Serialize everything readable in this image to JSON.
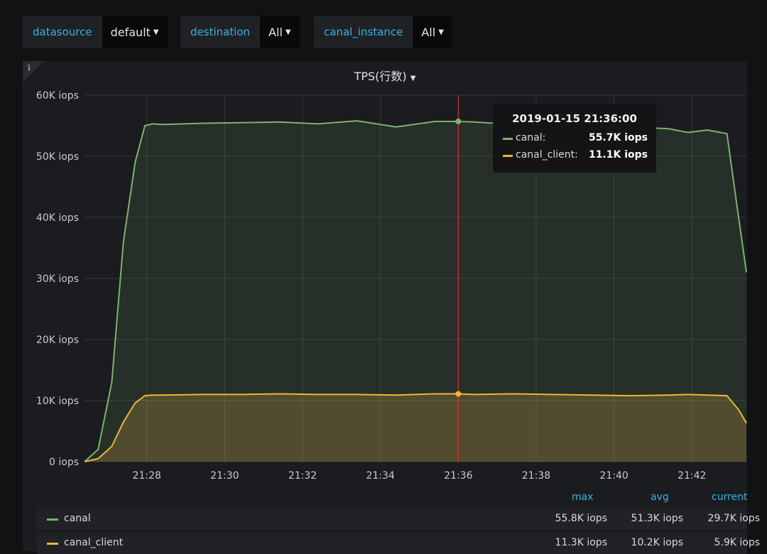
{
  "variables": [
    {
      "label": "datasource",
      "value": "default"
    },
    {
      "label": "destination",
      "value": "All"
    },
    {
      "label": "canal_instance",
      "value": "All"
    }
  ],
  "panel": {
    "title": "TPS(行数)",
    "info": "i"
  },
  "colors": {
    "canal": "#7eb26d",
    "canal_client": "#eab839",
    "crosshair": "#e02f2f",
    "accent": "#33b5e5"
  },
  "tooltip": {
    "time": "2019-01-15 21:36:00",
    "rows": [
      {
        "name": "canal:",
        "value": "55.7K iops"
      },
      {
        "name": "canal_client:",
        "value": "11.1K iops"
      }
    ]
  },
  "legend": {
    "headers": {
      "max": "max",
      "avg": "avg",
      "current": "current"
    },
    "rows": [
      {
        "name": "canal",
        "max": "55.8K iops",
        "avg": "51.3K iops",
        "current": "29.7K iops"
      },
      {
        "name": "canal_client",
        "max": "11.3K iops",
        "avg": "10.2K iops",
        "current": "5.9K iops"
      }
    ]
  },
  "chart_data": {
    "type": "area",
    "x_ticks": [
      "21:28",
      "21:30",
      "21:32",
      "21:34",
      "21:36",
      "21:38",
      "21:40",
      "21:42"
    ],
    "y_ticks": [
      "0 iops",
      "10K iops",
      "20K iops",
      "30K iops",
      "40K iops",
      "50K iops",
      "60K iops"
    ],
    "ylim": [
      0,
      60000
    ],
    "xlim_minutes": [
      0,
      17
    ],
    "grid": true,
    "cursor_minute": 9.6,
    "series": [
      {
        "name": "canal",
        "x": [
          0,
          0.35,
          0.7,
          1.0,
          1.3,
          1.55,
          1.75,
          2,
          3,
          4,
          5,
          6,
          7,
          8,
          9,
          9.6,
          10,
          11,
          12,
          13,
          14,
          15,
          15.5,
          16,
          16.5,
          16.8,
          17
        ],
        "y": [
          0,
          2000,
          13000,
          36000,
          49000,
          55000,
          55300,
          55200,
          55400,
          55500,
          55600,
          55300,
          55800,
          54800,
          55700,
          55700,
          55600,
          55200,
          55400,
          55100,
          54800,
          54500,
          53900,
          54300,
          53700,
          40000,
          31000
        ]
      },
      {
        "name": "canal_client",
        "x": [
          0,
          0.35,
          0.7,
          1.0,
          1.3,
          1.55,
          1.75,
          2,
          3,
          4,
          5,
          6,
          7,
          8,
          9,
          9.6,
          10,
          11,
          12,
          13,
          14,
          15,
          15.5,
          16,
          16.5,
          16.8,
          17
        ],
        "y": [
          0,
          500,
          2500,
          6500,
          9600,
          10800,
          10900,
          10900,
          11000,
          11000,
          11100,
          11000,
          11000,
          10900,
          11100,
          11100,
          11000,
          11100,
          11000,
          10900,
          10800,
          10900,
          11000,
          10900,
          10800,
          8500,
          6300
        ]
      }
    ]
  }
}
